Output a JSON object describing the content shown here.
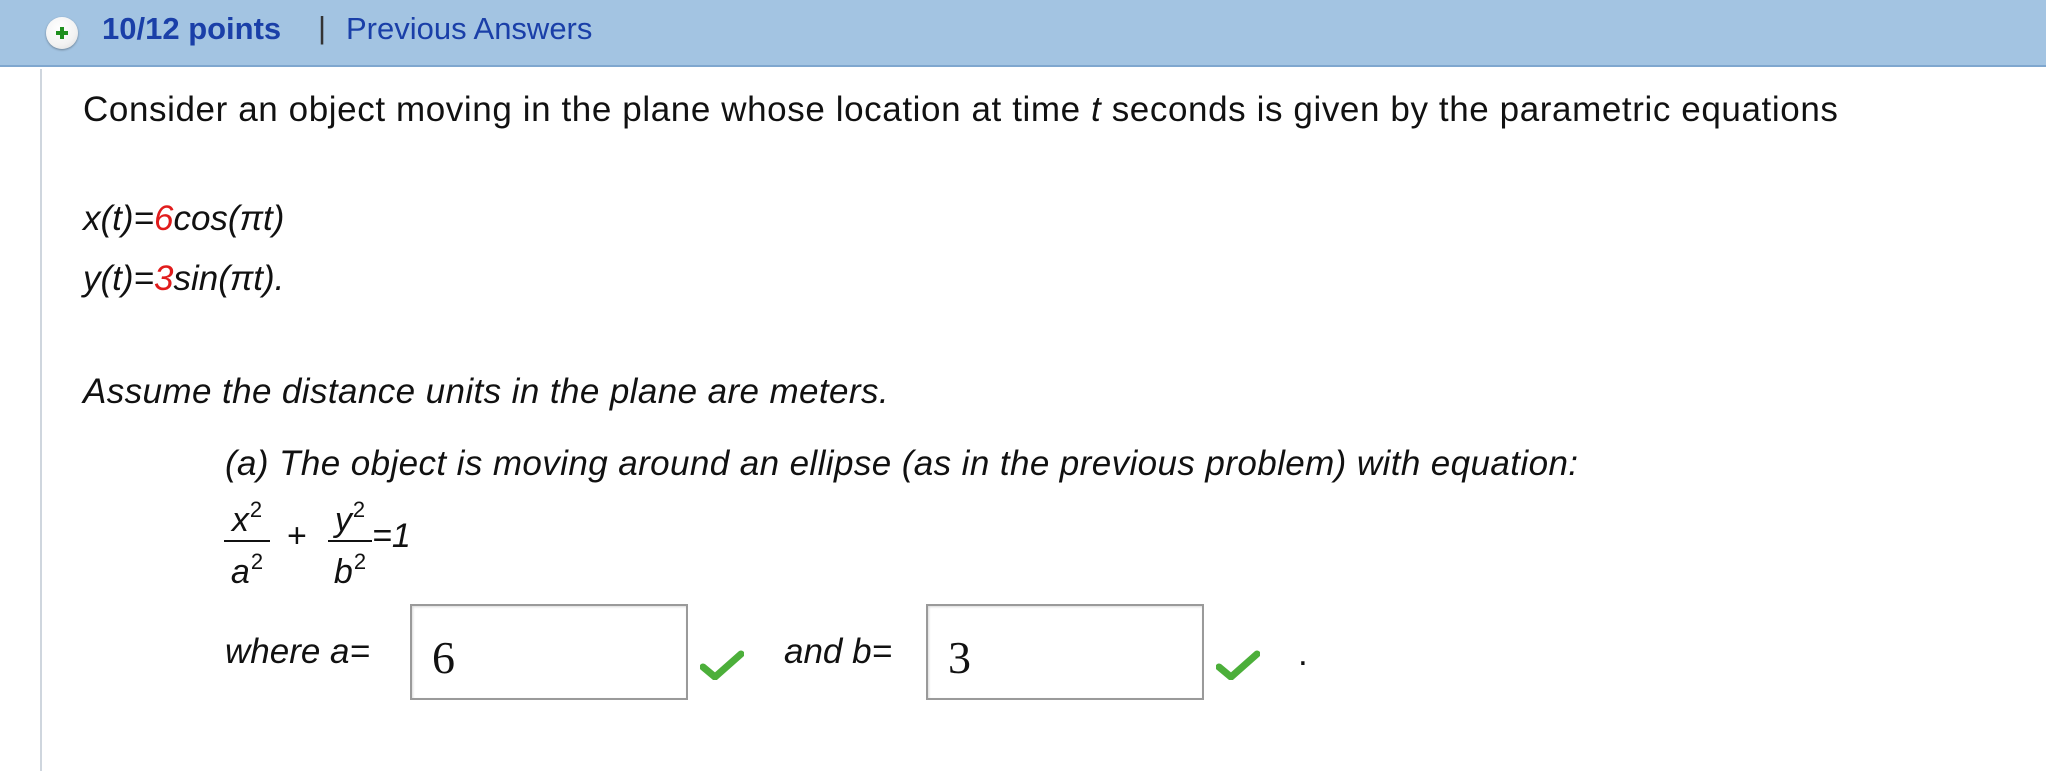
{
  "header": {
    "points": "10/12 points",
    "separator": "|",
    "previous_answers": "Previous Answers"
  },
  "question": {
    "intro_1": "Consider an object moving in the plane whose location at time ",
    "intro_var": "t",
    "intro_2": " seconds is given by the parametric equations",
    "eq_x_prefix": "x(t)=",
    "eq_x_coef": "6",
    "eq_x_suffix": "cos(πt)",
    "eq_y_prefix": "y(t)=",
    "eq_y_coef": "3",
    "eq_y_suffix": "sin(πt).",
    "assume": "Assume the distance units in the plane are meters.",
    "part_a": "(a) The object is moving around an ellipse (as in the previous problem) with equation:",
    "frac1_num": "x",
    "frac1_den": "a",
    "frac2_num": "y",
    "frac2_den": "b",
    "exponent": "2",
    "plus": "+",
    "equals_one": "=1",
    "label_a": "where a=",
    "label_b": "and b=",
    "period": "."
  },
  "answers": {
    "a_value": "6",
    "b_value": "3",
    "a_status": "correct",
    "b_status": "correct"
  },
  "colors": {
    "header_bg": "#a3c4e2",
    "link": "#1a3fa8",
    "coefficient": "#e11c1c",
    "check": "#4caf3a"
  }
}
